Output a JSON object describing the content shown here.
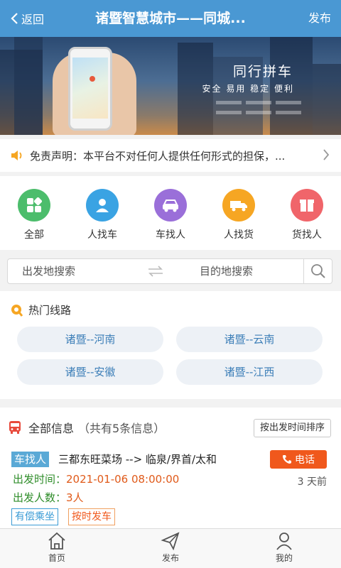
{
  "header": {
    "back_label": "返回",
    "title": "诸暨智慧城市——同城...",
    "publish_label": "发布"
  },
  "banner": {
    "title": "同行拼车",
    "subtitle": "安全 易用 稳定 便利"
  },
  "notice": {
    "text": "免责声明：本平台不对任何人提供任何形式的担保，..."
  },
  "categories": [
    {
      "label": "全部",
      "color": "#4cbd6c",
      "icon": "grid-icon"
    },
    {
      "label": "人找车",
      "color": "#3aa3e3",
      "icon": "person-icon"
    },
    {
      "label": "车找人",
      "color": "#9a6fd9",
      "icon": "car-icon"
    },
    {
      "label": "人找货",
      "color": "#f6a623",
      "icon": "truck-icon"
    },
    {
      "label": "货找人",
      "color": "#f0656a",
      "icon": "box-icon"
    }
  ],
  "search": {
    "from_placeholder": "出发地搜索",
    "to_placeholder": "目的地搜索"
  },
  "hot_routes": {
    "title": "热门线路",
    "routes": [
      "诸暨--河南",
      "诸暨--云南",
      "诸暨--安徽",
      "诸暨--江西"
    ]
  },
  "info": {
    "title": "全部信息",
    "count_text": "（共有5条信息）",
    "sort_label": "按出发时间排序",
    "post": {
      "type_tag": "车找人",
      "route": "三都东旺菜场 --> 临泉/界首/太和",
      "call_label": "电话",
      "depart_label": "出发时间：",
      "depart_value": "2021-01-06 08:00:00",
      "people_label": "出发人数：",
      "people_value": "3人",
      "ago": "3 天前",
      "tags": [
        "有偿乘坐",
        "按时发车"
      ]
    }
  },
  "tabbar": [
    {
      "label": "首页",
      "icon": "home-icon"
    },
    {
      "label": "发布",
      "icon": "send-icon"
    },
    {
      "label": "我的",
      "icon": "user-icon"
    }
  ],
  "colors": {
    "primary": "#4a98d3",
    "accent": "#f0581c",
    "green": "#2f8d2a"
  }
}
